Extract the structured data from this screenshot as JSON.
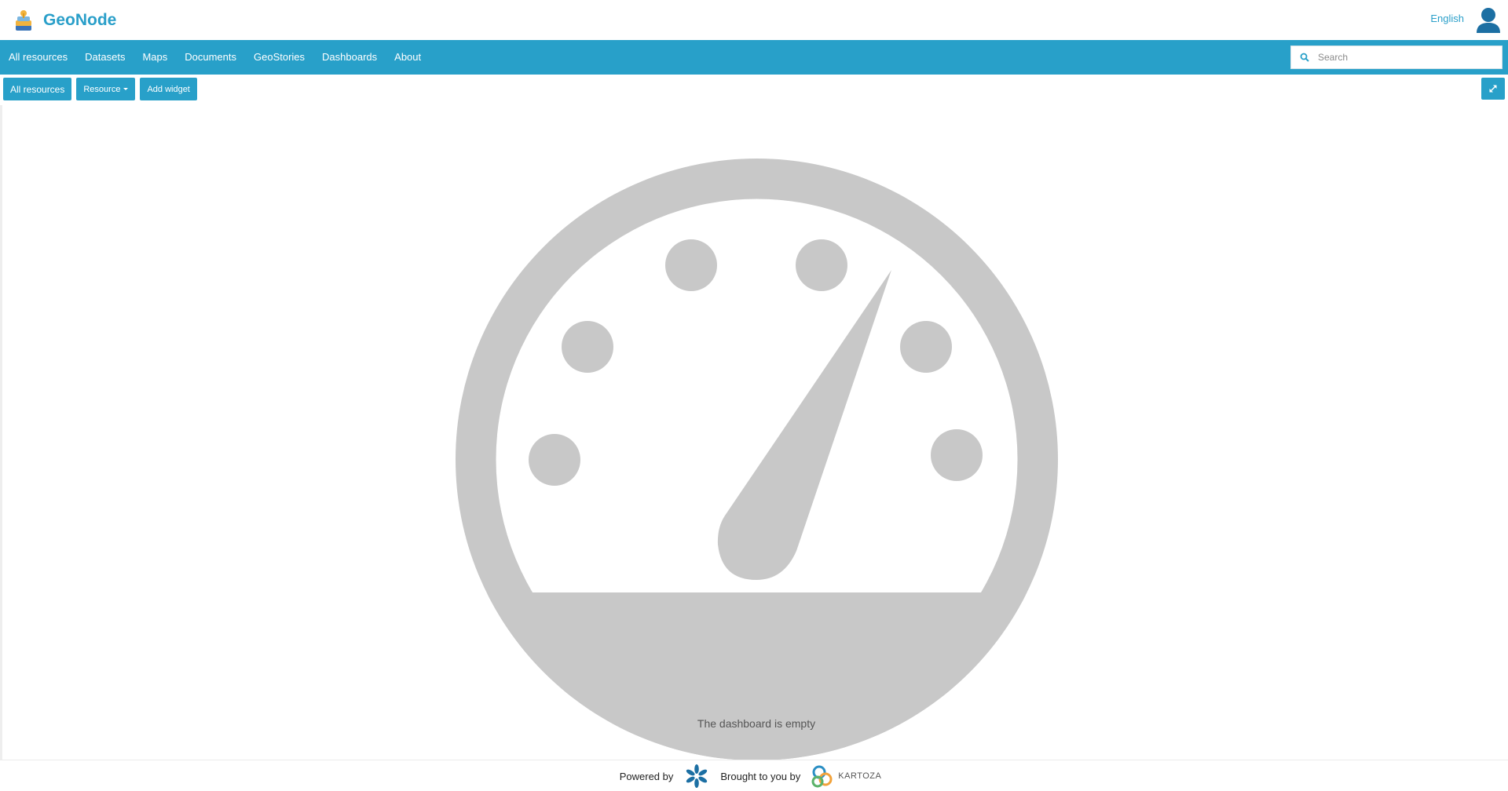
{
  "header": {
    "brand_name": "GeoNode",
    "language": "English"
  },
  "nav": {
    "items": [
      {
        "label": "All resources",
        "name": "nav-item-all-resources"
      },
      {
        "label": "Datasets",
        "name": "nav-item-datasets"
      },
      {
        "label": "Maps",
        "name": "nav-item-maps"
      },
      {
        "label": "Documents",
        "name": "nav-item-documents"
      },
      {
        "label": "GeoStories",
        "name": "nav-item-geostories"
      },
      {
        "label": "Dashboards",
        "name": "nav-item-dashboards"
      },
      {
        "label": "About",
        "name": "nav-item-about"
      }
    ]
  },
  "search": {
    "placeholder": "Search",
    "value": ""
  },
  "toolbar": {
    "all_resources_label": "All resources",
    "resource_label": "Resource",
    "add_widget_label": "Add widget"
  },
  "canvas": {
    "empty_message": "The dashboard is empty",
    "icon": "dashboard-gauge-icon"
  },
  "footer": {
    "powered_by": "Powered by",
    "brought_by": "Brought to you by",
    "brand_logo_text": "KARTOZA"
  },
  "colors": {
    "primary": "#28a0c9",
    "brand_text": "#2a9fc9",
    "gauge": "#c8c8c8",
    "user_icon": "#1c6fa3"
  }
}
